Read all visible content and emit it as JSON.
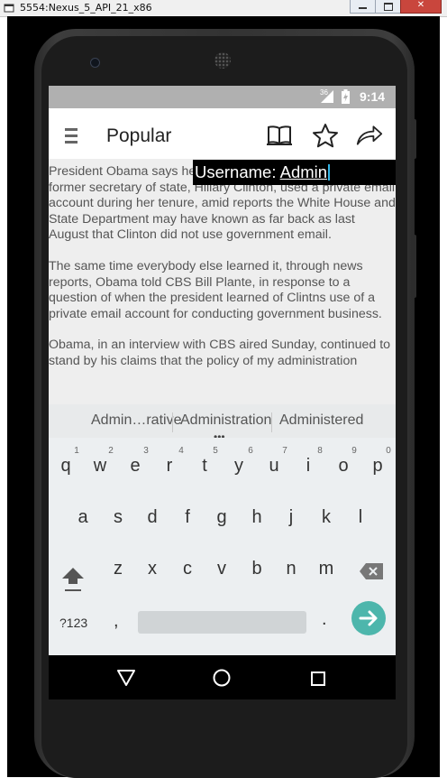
{
  "window": {
    "title": "5554:Nexus_5_API_21_x86"
  },
  "status_bar": {
    "network": "36",
    "time": "9:14"
  },
  "action_bar": {
    "title": "Popular",
    "icons": [
      "menu-icon",
      "book-icon",
      "star-icon",
      "share-icon"
    ]
  },
  "article": {
    "paragraphs": [
      "President Obama says he learned from news reports that his former secretary of state, Hillary Clinton, used a private email account during her tenure, amid reports the White House and State Department may have known as far back as last August that Clinton did not use government email.",
      "The same time everybody else learned it, through news reports, Obama told CBS Bill Plante, in response to a question of when the president learned of Clintns use of a private email account for conducting government business.",
      "Obama, in an interview with CBS aired Sunday, continued to stand by his claims that the policy of my administration"
    ]
  },
  "username_overlay": {
    "label": "Username: ",
    "value": "Admin"
  },
  "suggestions": [
    "Admin…rative",
    "Administration",
    "Administered"
  ],
  "keyboard": {
    "row1": [
      "q",
      "w",
      "e",
      "r",
      "t",
      "y",
      "u",
      "i",
      "o",
      "p"
    ],
    "row1_hints": [
      "1",
      "2",
      "3",
      "4",
      "5",
      "6",
      "7",
      "8",
      "9",
      "0"
    ],
    "row2": [
      "a",
      "s",
      "d",
      "f",
      "g",
      "h",
      "j",
      "k",
      "l"
    ],
    "row3": [
      "z",
      "x",
      "c",
      "v",
      "b",
      "n",
      "m"
    ],
    "symbols_label": "?123",
    "comma": ",",
    "period": ".",
    "enter_color": "#4db6ac"
  },
  "colors": {
    "status_bar": "#b0b0b0",
    "screen_bg": "#eeeeee",
    "overlay_bg": "#000000",
    "accent": "#4db6ac"
  }
}
